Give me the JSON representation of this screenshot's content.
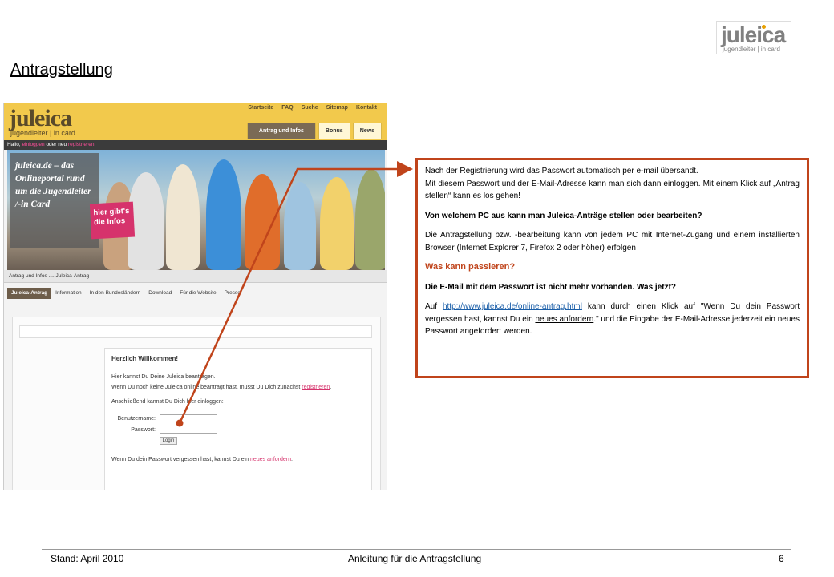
{
  "slide": {
    "title": "Antragstellung",
    "logo": {
      "word": "juleica",
      "sub": "jugendleiter | in card"
    }
  },
  "site": {
    "logo_word": "juleica",
    "logo_sub": "jugendleiter | in card",
    "topnav": [
      "Startseite",
      "FAQ",
      "Suche",
      "Sitemap",
      "Kontakt"
    ],
    "tabs": [
      "Antrag und Infos",
      "Bonus",
      "News"
    ],
    "hello": {
      "prefix": "Hallo, ",
      "login": "einloggen",
      "middle": " oder neu ",
      "register": "registrieren"
    },
    "hero_text": "juleica.de – das Onlineportal rund um die Jugendleiter /-in Card",
    "hero_badge": "hier gibt's die Infos",
    "breadcrumb": "Antrag und Infos .... Juleica-Antrag",
    "subnav": [
      "Juleica-Antrag",
      "Information",
      "In den Bundesländern",
      "Download",
      "Für die Website",
      "Presse"
    ],
    "login": {
      "welcome": "Herzlich Willkommen!",
      "line1": "Hier kannst Du Deine Juleica beantragen.",
      "line2_prefix": "Wenn Du noch keine Juleica online beantragt hast, musst Du Dich zunächst ",
      "line2_link": "registrieren",
      "line2_suffix": ".",
      "line3": "Anschließend kannst Du Dich hier einloggen:",
      "username_label": "Benutzername:",
      "password_label": "Passwort:",
      "button": "Login",
      "forgot_prefix": "Wenn Du dein Passwort vergessen hast, kannst Du ein ",
      "forgot_link": "neues anfordern",
      "forgot_suffix": "."
    }
  },
  "callout": {
    "p1_line1": "Nach der Registrierung wird das Passwort automatisch per e-mail übersandt.",
    "p1_line2": "Mit diesem Passwort und der E-Mail-Adresse kann man sich dann einloggen. Mit einem Klick auf „Antrag stellen“ kann es los gehen!",
    "q1": "Von welchem PC aus kann man Juleica-Anträge stellen oder bearbeiten?",
    "a1": "Die Antragstellung bzw. -bearbeitung kann von jedem PC mit Internet-Zugang und einem installierten Browser (Internet Explorer 7, Firefox 2 oder höher) erfolgen",
    "heading": "Was kann passieren?",
    "q2": "Die E-Mail mit dem Passwort ist nicht mehr vorhanden. Was jetzt?",
    "a2_prefix": "Auf ",
    "a2_link": "http://www.juleica.de/online-antrag.html",
    "a2_mid": " kann durch einen Klick auf \"Wenn Du dein Passwort vergessen hast, kannst Du ein ",
    "a2_link2": "neues anfordern",
    "a2_suffix": ".\" und die Eingabe der E-Mail-Adresse jederzeit ein neues Passwort angefordert werden."
  },
  "footer": {
    "left": "Stand: April 2010",
    "center": "Anleitung für die Antragstellung",
    "page": "6"
  },
  "colors": {
    "accent": "#c0441b",
    "site_yellow": "#f2c94c",
    "site_pink": "#d6336c"
  }
}
